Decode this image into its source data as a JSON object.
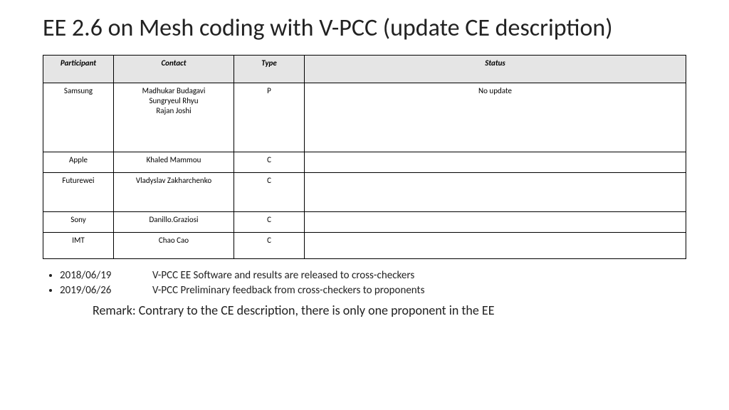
{
  "title": "EE 2.6 on Mesh coding with V-PCC (update CE description)",
  "table": {
    "headers": {
      "participant": "Participant",
      "contact": "Contact",
      "type": "Type",
      "status": "Status"
    },
    "rows": [
      {
        "participant": "Samsung",
        "contact": "Madhukar Budagavi\nSungryeul Rhyu\nRajan Joshi",
        "type": "P",
        "status": "No update"
      },
      {
        "participant": "Apple",
        "contact": "Khaled Mammou",
        "type": "C",
        "status": ""
      },
      {
        "participant": "Futurewei",
        "contact": "Vladyslav Zakharchenko",
        "type": "C",
        "status": ""
      },
      {
        "participant": "Sony",
        "contact": "Danillo.Graziosi",
        "type": "C",
        "status": ""
      },
      {
        "participant": "IMT",
        "contact": "Chao Cao",
        "type": "C",
        "status": ""
      }
    ]
  },
  "bullets": [
    {
      "date": "2018/06/19",
      "text": "V-PCC EE Software and results are released to cross-checkers"
    },
    {
      "date": "2019/06/26",
      "text": "V-PCC Preliminary feedback from cross-checkers to proponents"
    }
  ],
  "remark": "Remark: Contrary to the CE description, there is only one proponent in the EE"
}
